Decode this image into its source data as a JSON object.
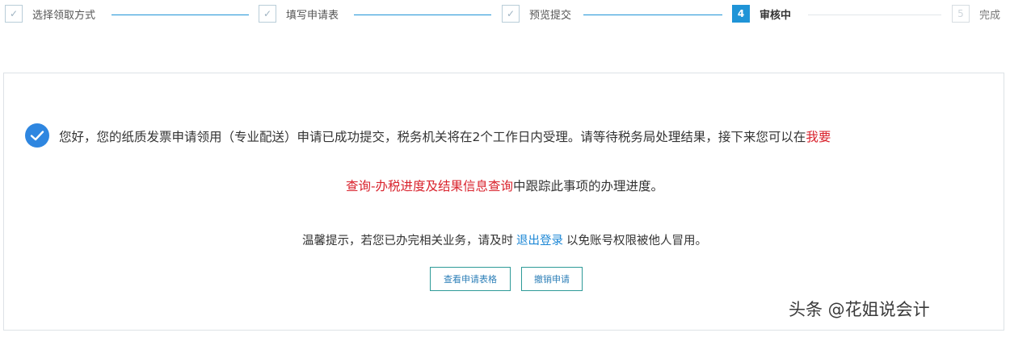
{
  "stepper": {
    "steps": [
      {
        "number": "✓",
        "label": "选择领取方式",
        "state": "done"
      },
      {
        "number": "✓",
        "label": "填写申请表",
        "state": "done"
      },
      {
        "number": "✓",
        "label": "预览提交",
        "state": "done"
      },
      {
        "number": "4",
        "label": "审核中",
        "state": "active"
      },
      {
        "number": "5",
        "label": "完成",
        "state": "pending"
      }
    ]
  },
  "message": {
    "line1_text": "您好，您的纸质发票申请领用（专业配送）申请已成功提交，税务机关将在2个工作日内受理。请等待税务局处理结果，接下来您可以在",
    "line1_red": "我要",
    "line2_red": "查询-办税进度及结果信息查询",
    "line2_text": "中跟踪此事项的办理进度。"
  },
  "tip": {
    "before": "温馨提示，若您已办完相关业务，请及时",
    "link": "退出登录",
    "after": "以免账号权限被他人冒用。"
  },
  "buttons": {
    "view_form": "查看申请表格",
    "revoke": "撤销申请"
  },
  "watermark": "头条 @花姐说会计",
  "colors": {
    "accent": "#1f94d7",
    "success_icon": "#2e86e0",
    "highlight_red": "#d9232d",
    "link_blue": "#1e88d6"
  }
}
